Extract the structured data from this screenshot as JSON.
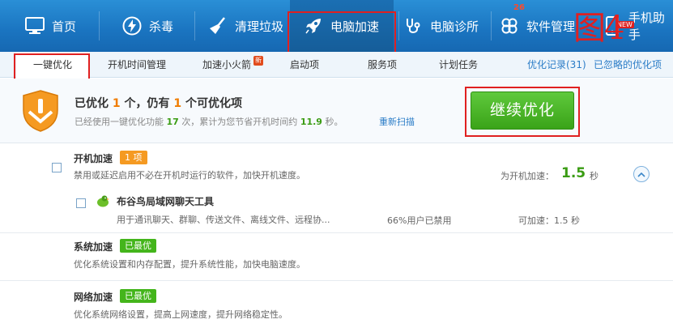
{
  "nav": {
    "items": [
      {
        "label": "首页",
        "icon": "monitor-icon"
      },
      {
        "label": "杀毒",
        "icon": "lightning-icon"
      },
      {
        "label": "清理垃圾",
        "icon": "broom-icon"
      },
      {
        "label": "电脑加速",
        "icon": "rocket-icon"
      },
      {
        "label": "电脑诊所",
        "icon": "stethoscope-icon"
      },
      {
        "label": "软件管理",
        "icon": "software-icon"
      },
      {
        "label": "手机助手",
        "icon": "phone-icon"
      }
    ],
    "active_index": 3,
    "software_badge": "26",
    "new_badge": "NEW",
    "figure_label": "图4"
  },
  "subtabs": {
    "items": [
      "一键优化",
      "开机时间管理",
      "加速小火箭",
      "启动项",
      "服务项",
      "计划任务"
    ],
    "active_index": 0,
    "hot_badge": "新",
    "record_link": "优化记录(31)",
    "ignored_link": "已忽略的优化项"
  },
  "summary": {
    "title_prefix": "已优化",
    "optimized_count": "1",
    "title_mid": "个，仍有",
    "remaining_count": "1",
    "title_suffix": "个可优化项",
    "sub_prefix": "已经使用一键优化功能",
    "use_times": "17",
    "sub_mid": "次，累计为您节省开机时间约",
    "saved_seconds": "11.9",
    "sub_suffix": "秒。",
    "rescan": "重新扫描",
    "continue_button": "继续优化"
  },
  "sections": {
    "startup": {
      "title": "开机加速",
      "tag": "1 项",
      "desc": "禁用或延迟启用不必在开机时运行的软件，加快开机速度。",
      "speedup_label": "为开机加速：",
      "speedup_value": "1.5",
      "speedup_unit": "秒",
      "item": {
        "name": "布谷鸟局域网聊天工具",
        "desc": "用于通讯聊天、群聊、传送文件、离线文件、远程协...",
        "users": "66%用户已禁用",
        "can_speed": "可加速：1.5 秒"
      }
    },
    "system": {
      "title": "系统加速",
      "tag": "已最优",
      "desc": "优化系统设置和内存配置，提升系统性能，加快电脑速度。"
    },
    "network": {
      "title": "网络加速",
      "tag": "已最优",
      "desc": "优化系统网络设置，提高上网速度，提升网络稳定性。"
    }
  },
  "colors": {
    "nav_blue": "#1a74c0",
    "highlight_red": "#e02020",
    "action_green": "#3aa318",
    "count_orange": "#f07c00"
  }
}
